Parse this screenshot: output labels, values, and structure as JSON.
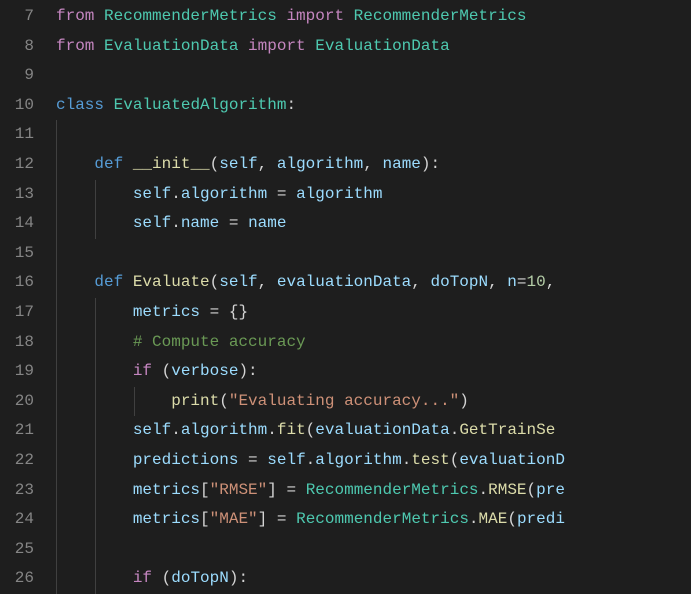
{
  "lines": [
    {
      "num": "7",
      "indent": 0,
      "tokens": [
        {
          "cls": "kw-purple",
          "t": "from"
        },
        {
          "cls": "white",
          "t": " "
        },
        {
          "cls": "cls-teal",
          "t": "RecommenderMetrics"
        },
        {
          "cls": "white",
          "t": " "
        },
        {
          "cls": "kw-purple",
          "t": "import"
        },
        {
          "cls": "white",
          "t": " "
        },
        {
          "cls": "cls-teal",
          "t": "RecommenderMetrics"
        }
      ]
    },
    {
      "num": "8",
      "indent": 0,
      "tokens": [
        {
          "cls": "kw-purple",
          "t": "from"
        },
        {
          "cls": "white",
          "t": " "
        },
        {
          "cls": "cls-teal",
          "t": "EvaluationData"
        },
        {
          "cls": "white",
          "t": " "
        },
        {
          "cls": "kw-purple",
          "t": "import"
        },
        {
          "cls": "white",
          "t": " "
        },
        {
          "cls": "cls-teal",
          "t": "EvaluationData"
        }
      ]
    },
    {
      "num": "9",
      "indent": 0,
      "tokens": []
    },
    {
      "num": "10",
      "indent": 0,
      "tokens": [
        {
          "cls": "kw-blue",
          "t": "class"
        },
        {
          "cls": "white",
          "t": " "
        },
        {
          "cls": "cls-teal",
          "t": "EvaluatedAlgorithm"
        },
        {
          "cls": "punct",
          "t": ":"
        }
      ]
    },
    {
      "num": "11",
      "indent": 1,
      "tokens": []
    },
    {
      "num": "12",
      "indent": 1,
      "tokens": [
        {
          "cls": "white",
          "t": "    "
        },
        {
          "cls": "kw-blue",
          "t": "def"
        },
        {
          "cls": "white",
          "t": " "
        },
        {
          "cls": "func-yellow",
          "t": "__init__"
        },
        {
          "cls": "punct",
          "t": "("
        },
        {
          "cls": "var-light",
          "t": "self"
        },
        {
          "cls": "punct",
          "t": ", "
        },
        {
          "cls": "var-light",
          "t": "algorithm"
        },
        {
          "cls": "punct",
          "t": ", "
        },
        {
          "cls": "var-light",
          "t": "name"
        },
        {
          "cls": "punct",
          "t": "):"
        }
      ]
    },
    {
      "num": "13",
      "indent": 2,
      "tokens": [
        {
          "cls": "white",
          "t": "        "
        },
        {
          "cls": "var-light",
          "t": "self"
        },
        {
          "cls": "punct",
          "t": "."
        },
        {
          "cls": "var-light",
          "t": "algorithm"
        },
        {
          "cls": "white",
          "t": " "
        },
        {
          "cls": "punct",
          "t": "="
        },
        {
          "cls": "white",
          "t": " "
        },
        {
          "cls": "var-light",
          "t": "algorithm"
        }
      ]
    },
    {
      "num": "14",
      "indent": 2,
      "tokens": [
        {
          "cls": "white",
          "t": "        "
        },
        {
          "cls": "var-light",
          "t": "self"
        },
        {
          "cls": "punct",
          "t": "."
        },
        {
          "cls": "var-light",
          "t": "name"
        },
        {
          "cls": "white",
          "t": " "
        },
        {
          "cls": "punct",
          "t": "="
        },
        {
          "cls": "white",
          "t": " "
        },
        {
          "cls": "var-light",
          "t": "name"
        }
      ]
    },
    {
      "num": "15",
      "indent": 1,
      "tokens": []
    },
    {
      "num": "16",
      "indent": 1,
      "tokens": [
        {
          "cls": "white",
          "t": "    "
        },
        {
          "cls": "kw-blue",
          "t": "def"
        },
        {
          "cls": "white",
          "t": " "
        },
        {
          "cls": "func-yellow",
          "t": "Evaluate"
        },
        {
          "cls": "punct",
          "t": "("
        },
        {
          "cls": "var-light",
          "t": "self"
        },
        {
          "cls": "punct",
          "t": ", "
        },
        {
          "cls": "var-light",
          "t": "evaluationData"
        },
        {
          "cls": "punct",
          "t": ", "
        },
        {
          "cls": "var-light",
          "t": "doTopN"
        },
        {
          "cls": "punct",
          "t": ", "
        },
        {
          "cls": "var-light",
          "t": "n"
        },
        {
          "cls": "punct",
          "t": "="
        },
        {
          "cls": "num-green",
          "t": "10"
        },
        {
          "cls": "punct",
          "t": ", "
        }
      ]
    },
    {
      "num": "17",
      "indent": 2,
      "tokens": [
        {
          "cls": "white",
          "t": "        "
        },
        {
          "cls": "var-light",
          "t": "metrics"
        },
        {
          "cls": "white",
          "t": " "
        },
        {
          "cls": "punct",
          "t": "="
        },
        {
          "cls": "white",
          "t": " "
        },
        {
          "cls": "punct",
          "t": "{}"
        }
      ]
    },
    {
      "num": "18",
      "indent": 2,
      "tokens": [
        {
          "cls": "white",
          "t": "        "
        },
        {
          "cls": "comment-green",
          "t": "# Compute accuracy"
        }
      ]
    },
    {
      "num": "19",
      "indent": 2,
      "tokens": [
        {
          "cls": "white",
          "t": "        "
        },
        {
          "cls": "kw-purple",
          "t": "if"
        },
        {
          "cls": "white",
          "t": " "
        },
        {
          "cls": "punct",
          "t": "("
        },
        {
          "cls": "var-light",
          "t": "verbose"
        },
        {
          "cls": "punct",
          "t": "):"
        }
      ]
    },
    {
      "num": "20",
      "indent": 3,
      "tokens": [
        {
          "cls": "white",
          "t": "            "
        },
        {
          "cls": "func-yellow",
          "t": "print"
        },
        {
          "cls": "punct",
          "t": "("
        },
        {
          "cls": "str-orange",
          "t": "\"Evaluating accuracy...\""
        },
        {
          "cls": "punct",
          "t": ")"
        }
      ]
    },
    {
      "num": "21",
      "indent": 2,
      "tokens": [
        {
          "cls": "white",
          "t": "        "
        },
        {
          "cls": "var-light",
          "t": "self"
        },
        {
          "cls": "punct",
          "t": "."
        },
        {
          "cls": "var-light",
          "t": "algorithm"
        },
        {
          "cls": "punct",
          "t": "."
        },
        {
          "cls": "func-yellow",
          "t": "fit"
        },
        {
          "cls": "punct",
          "t": "("
        },
        {
          "cls": "var-light",
          "t": "evaluationData"
        },
        {
          "cls": "punct",
          "t": "."
        },
        {
          "cls": "func-yellow",
          "t": "GetTrainSe"
        }
      ]
    },
    {
      "num": "22",
      "indent": 2,
      "tokens": [
        {
          "cls": "white",
          "t": "        "
        },
        {
          "cls": "var-light",
          "t": "predictions"
        },
        {
          "cls": "white",
          "t": " "
        },
        {
          "cls": "punct",
          "t": "="
        },
        {
          "cls": "white",
          "t": " "
        },
        {
          "cls": "var-light",
          "t": "self"
        },
        {
          "cls": "punct",
          "t": "."
        },
        {
          "cls": "var-light",
          "t": "algorithm"
        },
        {
          "cls": "punct",
          "t": "."
        },
        {
          "cls": "func-yellow",
          "t": "test"
        },
        {
          "cls": "punct",
          "t": "("
        },
        {
          "cls": "var-light",
          "t": "evaluationD"
        }
      ]
    },
    {
      "num": "23",
      "indent": 2,
      "tokens": [
        {
          "cls": "white",
          "t": "        "
        },
        {
          "cls": "var-light",
          "t": "metrics"
        },
        {
          "cls": "punct",
          "t": "["
        },
        {
          "cls": "str-orange",
          "t": "\"RMSE\""
        },
        {
          "cls": "punct",
          "t": "]"
        },
        {
          "cls": "white",
          "t": " "
        },
        {
          "cls": "punct",
          "t": "="
        },
        {
          "cls": "white",
          "t": " "
        },
        {
          "cls": "cls-teal",
          "t": "RecommenderMetrics"
        },
        {
          "cls": "punct",
          "t": "."
        },
        {
          "cls": "func-yellow",
          "t": "RMSE"
        },
        {
          "cls": "punct",
          "t": "("
        },
        {
          "cls": "var-light",
          "t": "pre"
        }
      ]
    },
    {
      "num": "24",
      "indent": 2,
      "tokens": [
        {
          "cls": "white",
          "t": "        "
        },
        {
          "cls": "var-light",
          "t": "metrics"
        },
        {
          "cls": "punct",
          "t": "["
        },
        {
          "cls": "str-orange",
          "t": "\"MAE\""
        },
        {
          "cls": "punct",
          "t": "]"
        },
        {
          "cls": "white",
          "t": " "
        },
        {
          "cls": "punct",
          "t": "="
        },
        {
          "cls": "white",
          "t": " "
        },
        {
          "cls": "cls-teal",
          "t": "RecommenderMetrics"
        },
        {
          "cls": "punct",
          "t": "."
        },
        {
          "cls": "func-yellow",
          "t": "MAE"
        },
        {
          "cls": "punct",
          "t": "("
        },
        {
          "cls": "var-light",
          "t": "predi"
        }
      ]
    },
    {
      "num": "25",
      "indent": 2,
      "tokens": []
    },
    {
      "num": "26",
      "indent": 2,
      "tokens": [
        {
          "cls": "white",
          "t": "        "
        },
        {
          "cls": "kw-purple",
          "t": "if"
        },
        {
          "cls": "white",
          "t": " "
        },
        {
          "cls": "punct",
          "t": "("
        },
        {
          "cls": "var-light",
          "t": "doTopN"
        },
        {
          "cls": "punct",
          "t": "):"
        }
      ]
    }
  ],
  "indentWidth": 39
}
